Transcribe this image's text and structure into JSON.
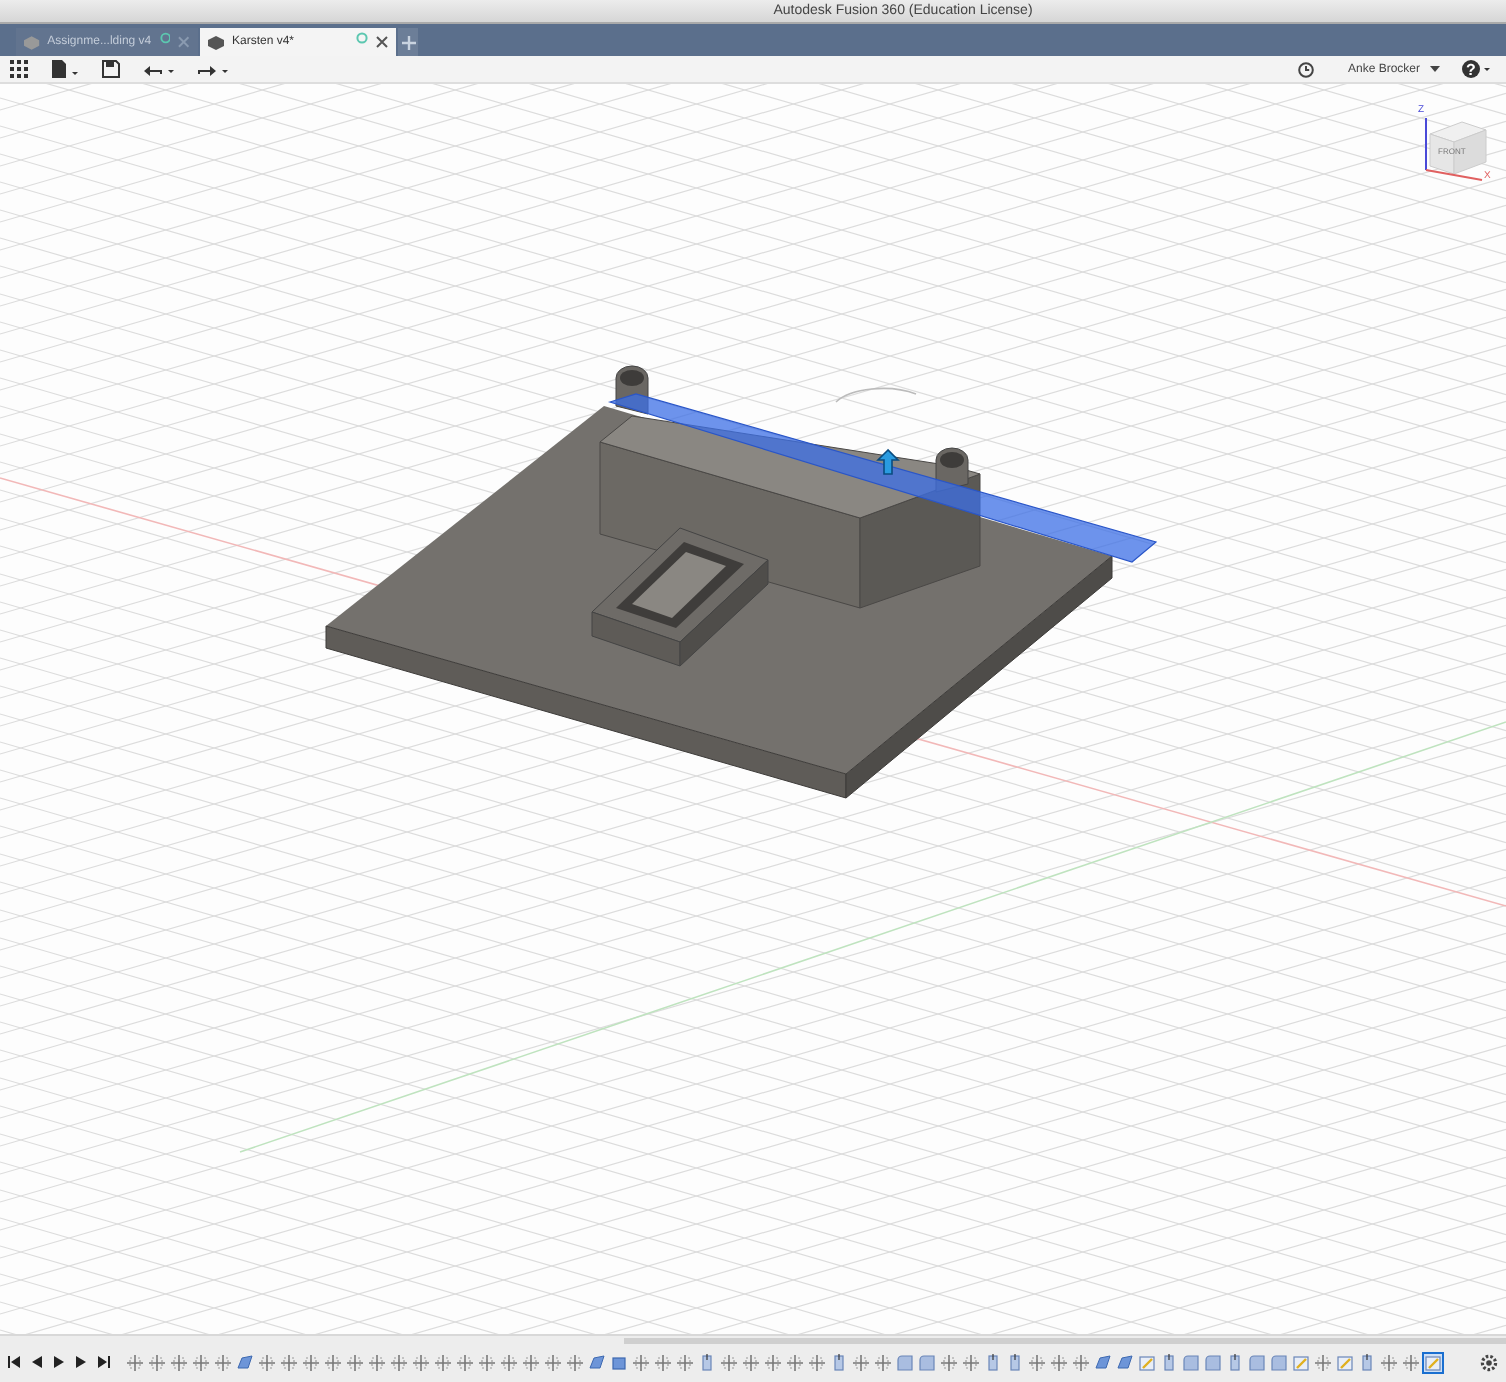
{
  "window": {
    "title": "Autodesk Fusion 360 (Education License)"
  },
  "tabs": [
    {
      "label": "Assignme...lding v4",
      "selected": false
    },
    {
      "label": "Karsten v4*",
      "selected": true
    }
  ],
  "toolbar": {
    "user": "Anke Brocker",
    "help_symbol": "?"
  },
  "view_cube": {
    "face_label": "FRONT",
    "axis_labels": [
      "Z",
      "X"
    ]
  },
  "timeline": {
    "items": [
      {
        "kind": "sketch",
        "selected": false
      },
      {
        "kind": "sketch",
        "selected": false
      },
      {
        "kind": "sketch",
        "selected": false
      },
      {
        "kind": "sketch",
        "selected": false
      },
      {
        "kind": "sketch",
        "selected": false
      },
      {
        "kind": "body",
        "selected": false
      },
      {
        "kind": "sketch",
        "selected": false
      },
      {
        "kind": "sketch",
        "selected": false
      },
      {
        "kind": "sketch",
        "selected": false
      },
      {
        "kind": "sketch",
        "selected": false
      },
      {
        "kind": "sketch",
        "selected": false
      },
      {
        "kind": "sketch",
        "selected": false
      },
      {
        "kind": "sketch",
        "selected": false
      },
      {
        "kind": "sketch",
        "selected": false
      },
      {
        "kind": "sketch",
        "selected": false
      },
      {
        "kind": "sketch",
        "selected": false
      },
      {
        "kind": "sketch",
        "selected": false
      },
      {
        "kind": "sketch",
        "selected": false
      },
      {
        "kind": "sketch",
        "selected": false
      },
      {
        "kind": "sketch",
        "selected": false
      },
      {
        "kind": "sketch",
        "selected": false
      },
      {
        "kind": "body",
        "selected": false
      },
      {
        "kind": "box",
        "selected": false
      },
      {
        "kind": "sketch",
        "selected": false
      },
      {
        "kind": "sketch",
        "selected": false
      },
      {
        "kind": "sketch",
        "selected": false
      },
      {
        "kind": "extrude",
        "selected": false
      },
      {
        "kind": "sketch",
        "selected": false
      },
      {
        "kind": "sketch",
        "selected": false
      },
      {
        "kind": "sketch",
        "selected": false
      },
      {
        "kind": "sketch",
        "selected": false
      },
      {
        "kind": "sketch",
        "selected": false
      },
      {
        "kind": "extrude",
        "selected": false
      },
      {
        "kind": "sketch",
        "selected": false
      },
      {
        "kind": "sketch",
        "selected": false
      },
      {
        "kind": "fillet",
        "selected": false
      },
      {
        "kind": "fillet",
        "selected": false
      },
      {
        "kind": "sketch",
        "selected": false
      },
      {
        "kind": "sketch",
        "selected": false
      },
      {
        "kind": "extrude",
        "selected": false
      },
      {
        "kind": "extrude",
        "selected": false
      },
      {
        "kind": "sketch",
        "selected": false
      },
      {
        "kind": "sketch",
        "selected": false
      },
      {
        "kind": "sketch",
        "selected": false
      },
      {
        "kind": "body",
        "selected": false
      },
      {
        "kind": "body",
        "selected": false
      },
      {
        "kind": "edit",
        "selected": false
      },
      {
        "kind": "extrude",
        "selected": false
      },
      {
        "kind": "fillet",
        "selected": false
      },
      {
        "kind": "fillet",
        "selected": false
      },
      {
        "kind": "extrude",
        "selected": false
      },
      {
        "kind": "fillet",
        "selected": false
      },
      {
        "kind": "fillet",
        "selected": false
      },
      {
        "kind": "edit",
        "selected": false
      },
      {
        "kind": "sketch",
        "selected": false
      },
      {
        "kind": "edit",
        "selected": false
      },
      {
        "kind": "extrude",
        "selected": false
      },
      {
        "kind": "sketch",
        "selected": false
      },
      {
        "kind": "sketch",
        "selected": false
      },
      {
        "kind": "edit",
        "selected": true
      }
    ]
  }
}
